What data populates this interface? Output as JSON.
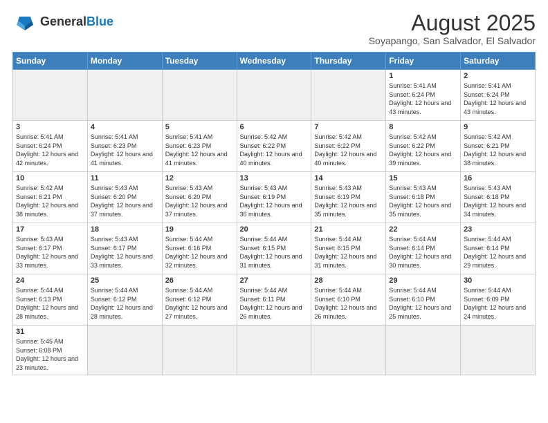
{
  "header": {
    "logo_general": "General",
    "logo_blue": "Blue",
    "month_year": "August 2025",
    "location": "Soyapango, San Salvador, El Salvador"
  },
  "weekdays": [
    "Sunday",
    "Monday",
    "Tuesday",
    "Wednesday",
    "Thursday",
    "Friday",
    "Saturday"
  ],
  "weeks": [
    [
      {
        "day": "",
        "info": "",
        "empty": true
      },
      {
        "day": "",
        "info": "",
        "empty": true
      },
      {
        "day": "",
        "info": "",
        "empty": true
      },
      {
        "day": "",
        "info": "",
        "empty": true
      },
      {
        "day": "",
        "info": "",
        "empty": true
      },
      {
        "day": "1",
        "info": "Sunrise: 5:41 AM\nSunset: 6:24 PM\nDaylight: 12 hours\nand 43 minutes."
      },
      {
        "day": "2",
        "info": "Sunrise: 5:41 AM\nSunset: 6:24 PM\nDaylight: 12 hours\nand 43 minutes."
      }
    ],
    [
      {
        "day": "3",
        "info": "Sunrise: 5:41 AM\nSunset: 6:24 PM\nDaylight: 12 hours\nand 42 minutes."
      },
      {
        "day": "4",
        "info": "Sunrise: 5:41 AM\nSunset: 6:23 PM\nDaylight: 12 hours\nand 41 minutes."
      },
      {
        "day": "5",
        "info": "Sunrise: 5:41 AM\nSunset: 6:23 PM\nDaylight: 12 hours\nand 41 minutes."
      },
      {
        "day": "6",
        "info": "Sunrise: 5:42 AM\nSunset: 6:22 PM\nDaylight: 12 hours\nand 40 minutes."
      },
      {
        "day": "7",
        "info": "Sunrise: 5:42 AM\nSunset: 6:22 PM\nDaylight: 12 hours\nand 40 minutes."
      },
      {
        "day": "8",
        "info": "Sunrise: 5:42 AM\nSunset: 6:22 PM\nDaylight: 12 hours\nand 39 minutes."
      },
      {
        "day": "9",
        "info": "Sunrise: 5:42 AM\nSunset: 6:21 PM\nDaylight: 12 hours\nand 38 minutes."
      }
    ],
    [
      {
        "day": "10",
        "info": "Sunrise: 5:42 AM\nSunset: 6:21 PM\nDaylight: 12 hours\nand 38 minutes."
      },
      {
        "day": "11",
        "info": "Sunrise: 5:43 AM\nSunset: 6:20 PM\nDaylight: 12 hours\nand 37 minutes."
      },
      {
        "day": "12",
        "info": "Sunrise: 5:43 AM\nSunset: 6:20 PM\nDaylight: 12 hours\nand 37 minutes."
      },
      {
        "day": "13",
        "info": "Sunrise: 5:43 AM\nSunset: 6:19 PM\nDaylight: 12 hours\nand 36 minutes."
      },
      {
        "day": "14",
        "info": "Sunrise: 5:43 AM\nSunset: 6:19 PM\nDaylight: 12 hours\nand 35 minutes."
      },
      {
        "day": "15",
        "info": "Sunrise: 5:43 AM\nSunset: 6:18 PM\nDaylight: 12 hours\nand 35 minutes."
      },
      {
        "day": "16",
        "info": "Sunrise: 5:43 AM\nSunset: 6:18 PM\nDaylight: 12 hours\nand 34 minutes."
      }
    ],
    [
      {
        "day": "17",
        "info": "Sunrise: 5:43 AM\nSunset: 6:17 PM\nDaylight: 12 hours\nand 33 minutes."
      },
      {
        "day": "18",
        "info": "Sunrise: 5:43 AM\nSunset: 6:17 PM\nDaylight: 12 hours\nand 33 minutes."
      },
      {
        "day": "19",
        "info": "Sunrise: 5:44 AM\nSunset: 6:16 PM\nDaylight: 12 hours\nand 32 minutes."
      },
      {
        "day": "20",
        "info": "Sunrise: 5:44 AM\nSunset: 6:15 PM\nDaylight: 12 hours\nand 31 minutes."
      },
      {
        "day": "21",
        "info": "Sunrise: 5:44 AM\nSunset: 6:15 PM\nDaylight: 12 hours\nand 31 minutes."
      },
      {
        "day": "22",
        "info": "Sunrise: 5:44 AM\nSunset: 6:14 PM\nDaylight: 12 hours\nand 30 minutes."
      },
      {
        "day": "23",
        "info": "Sunrise: 5:44 AM\nSunset: 6:14 PM\nDaylight: 12 hours\nand 29 minutes."
      }
    ],
    [
      {
        "day": "24",
        "info": "Sunrise: 5:44 AM\nSunset: 6:13 PM\nDaylight: 12 hours\nand 28 minutes."
      },
      {
        "day": "25",
        "info": "Sunrise: 5:44 AM\nSunset: 6:12 PM\nDaylight: 12 hours\nand 28 minutes."
      },
      {
        "day": "26",
        "info": "Sunrise: 5:44 AM\nSunset: 6:12 PM\nDaylight: 12 hours\nand 27 minutes."
      },
      {
        "day": "27",
        "info": "Sunrise: 5:44 AM\nSunset: 6:11 PM\nDaylight: 12 hours\nand 26 minutes."
      },
      {
        "day": "28",
        "info": "Sunrise: 5:44 AM\nSunset: 6:10 PM\nDaylight: 12 hours\nand 26 minutes."
      },
      {
        "day": "29",
        "info": "Sunrise: 5:44 AM\nSunset: 6:10 PM\nDaylight: 12 hours\nand 25 minutes."
      },
      {
        "day": "30",
        "info": "Sunrise: 5:44 AM\nSunset: 6:09 PM\nDaylight: 12 hours\nand 24 minutes."
      }
    ],
    [
      {
        "day": "31",
        "info": "Sunrise: 5:45 AM\nSunset: 6:08 PM\nDaylight: 12 hours\nand 23 minutes.",
        "last": true
      },
      {
        "day": "",
        "info": "",
        "empty": true,
        "last": true
      },
      {
        "day": "",
        "info": "",
        "empty": true,
        "last": true
      },
      {
        "day": "",
        "info": "",
        "empty": true,
        "last": true
      },
      {
        "day": "",
        "info": "",
        "empty": true,
        "last": true
      },
      {
        "day": "",
        "info": "",
        "empty": true,
        "last": true
      },
      {
        "day": "",
        "info": "",
        "empty": true,
        "last": true
      }
    ]
  ]
}
